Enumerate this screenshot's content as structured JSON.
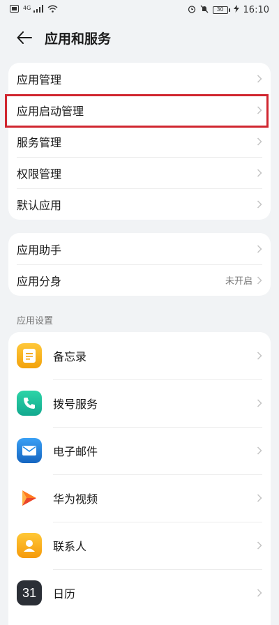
{
  "status_bar": {
    "left_icons": [
      "sim-icon",
      "signal-icon",
      "wifi-icon"
    ],
    "signal_text": "4G",
    "right_icons": [
      "alarm-icon",
      "mute-icon",
      "battery-icon",
      "charging-icon"
    ],
    "battery_text": "30",
    "time": "16:10"
  },
  "header": {
    "title": "应用和服务",
    "back_icon": "back-arrow-icon"
  },
  "group1": {
    "items": [
      {
        "label": "应用管理"
      },
      {
        "label": "应用启动管理"
      },
      {
        "label": "服务管理"
      },
      {
        "label": "权限管理"
      },
      {
        "label": "默认应用"
      }
    ]
  },
  "group2": {
    "items": [
      {
        "label": "应用助手",
        "value": ""
      },
      {
        "label": "应用分身",
        "value": "未开启"
      }
    ]
  },
  "app_settings": {
    "title": "应用设置",
    "apps": [
      {
        "label": "备忘录",
        "icon": "notes-icon",
        "color": "#f5b21c"
      },
      {
        "label": "拨号服务",
        "icon": "phone-icon",
        "color": "#1bb99f"
      },
      {
        "label": "电子邮件",
        "icon": "mail-icon",
        "color": "#1e88e5"
      },
      {
        "label": "华为视频",
        "icon": "video-icon",
        "color": "#ff6a1f"
      },
      {
        "label": "联系人",
        "icon": "contacts-icon",
        "color": "#f9a825"
      },
      {
        "label": "日历",
        "icon": "calendar-icon",
        "color": "#2b2f36",
        "icon_text": "31"
      }
    ]
  },
  "highlight_color": "#d0262f"
}
